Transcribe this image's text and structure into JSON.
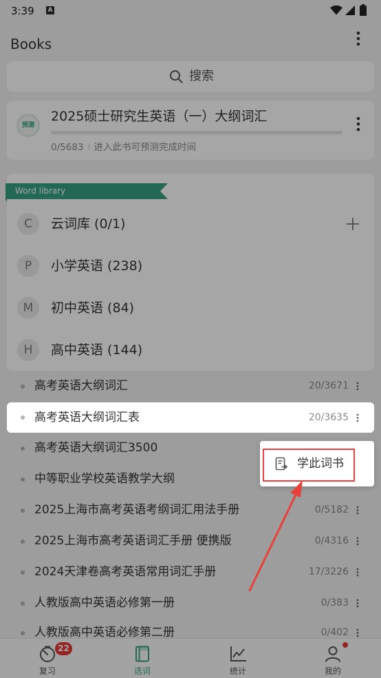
{
  "status_bar": {
    "time": "3:39",
    "notification_glyph": "A",
    "icons": [
      "wifi-icon",
      "signal-icon",
      "battery-icon"
    ]
  },
  "header": {
    "title": "Books",
    "menu_icon": "more-vert-icon"
  },
  "search": {
    "placeholder": "搜索",
    "icon": "search-icon"
  },
  "current_book": {
    "badge": "预测",
    "title": "2025硕士研究生英语（一）大纲词汇",
    "progress_ratio": 0,
    "progress_text": "0/5683",
    "hint": "进入此书可预测完成时间"
  },
  "library": {
    "label": "Word library",
    "categories": [
      {
        "letter": "C",
        "name": "云词库 (0/1)",
        "action_icon": "add-icon"
      },
      {
        "letter": "P",
        "name": "小学英语 (238)"
      },
      {
        "letter": "M",
        "name": "初中英语 (84)"
      },
      {
        "letter": "H",
        "name": "高中英语 (144)"
      }
    ],
    "books": [
      {
        "name": "高考英语大纲词汇",
        "progress": "20/3671"
      },
      {
        "name": "高考英语大纲词汇表",
        "progress": "20/3635",
        "selected": true
      },
      {
        "name": "高考英语大纲词汇3500"
      },
      {
        "name": "中等职业学校英语教学大纲"
      },
      {
        "name": "2025上海市高考英语考纲词汇用法手册",
        "progress": "0/5182"
      },
      {
        "name": "2025上海市高考英语词汇手册 便携版",
        "progress": "0/4316"
      },
      {
        "name": "2024天津卷高考英语常用词汇手册",
        "progress": "17/3226"
      },
      {
        "name": "人教版高中英语必修第一册",
        "progress": "0/383"
      },
      {
        "name": "人教版高中英语必修第二册",
        "progress": "0/402"
      }
    ]
  },
  "context_menu": {
    "items": [
      {
        "label": "学此词书",
        "icon": "study-book-icon"
      }
    ]
  },
  "bottom_nav": {
    "items": [
      {
        "label": "复习",
        "icon": "review-timer-icon",
        "badge": "22"
      },
      {
        "label": "选词",
        "icon": "book-select-icon",
        "active": true
      },
      {
        "label": "统计",
        "icon": "stats-chart-icon"
      },
      {
        "label": "我的",
        "icon": "profile-icon",
        "dot": true
      }
    ]
  },
  "colors": {
    "accent": "#36a07e",
    "badge_red": "#e53935",
    "annotation_red": "#e8403a",
    "dim_overlay": "rgba(0,0,0,0.35)"
  }
}
